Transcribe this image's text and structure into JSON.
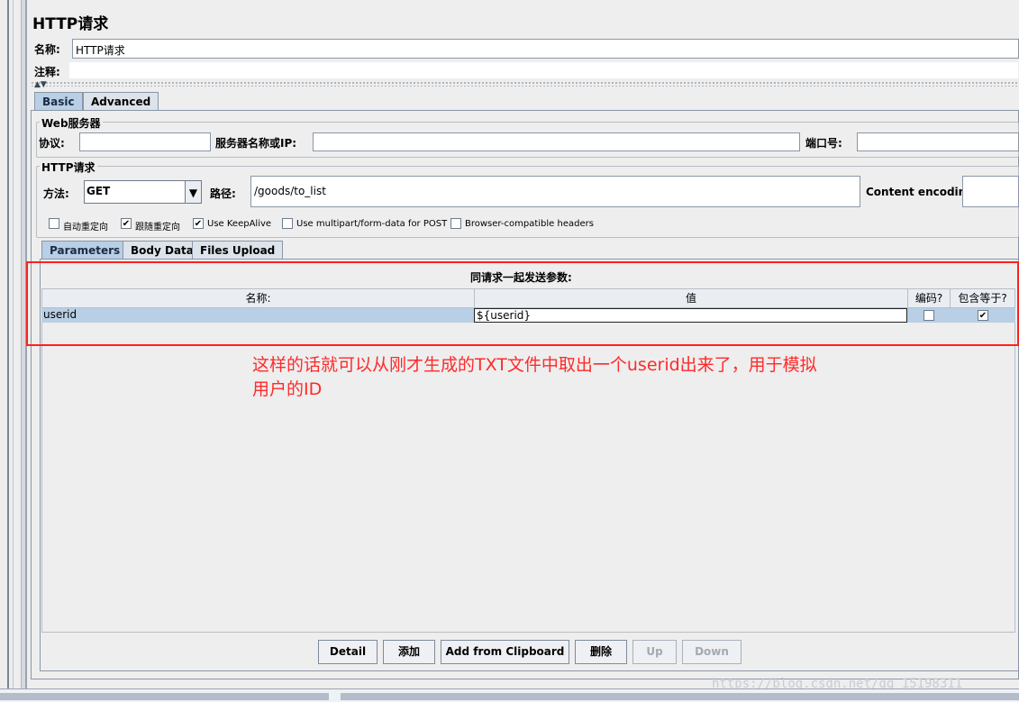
{
  "window": {
    "title": "HTTP请求"
  },
  "fields": {
    "name_label": "名称:",
    "name_value": "HTTP请求",
    "comment_label": "注释:",
    "comment_value": ""
  },
  "tabs": [
    {
      "label": "Basic",
      "active": true
    },
    {
      "label": "Advanced",
      "active": false
    }
  ],
  "web_server": {
    "title": "Web服务器",
    "protocol_label": "协议:",
    "protocol_value": "",
    "server_label": "服务器名称或IP:",
    "server_value": "",
    "port_label": "端口号:",
    "port_value": ""
  },
  "http_request": {
    "title": "HTTP请求",
    "method_label": "方法:",
    "method_value": "GET",
    "path_label": "路径:",
    "path_value": "/goods/to_list",
    "encoding_label": "Content encoding:",
    "encoding_value": ""
  },
  "options": [
    {
      "label": "自动重定向",
      "checked": false
    },
    {
      "label": "跟随重定向",
      "checked": true
    },
    {
      "label": "Use KeepAlive",
      "checked": true
    },
    {
      "label": "Use multipart/form-data for POST",
      "checked": false
    },
    {
      "label": "Browser-compatible headers",
      "checked": false
    }
  ],
  "sub_tabs": [
    {
      "label": "Parameters",
      "active": true
    },
    {
      "label": "Body Data",
      "active": false
    },
    {
      "label": "Files Upload",
      "active": false
    }
  ],
  "params_table": {
    "caption": "同请求一起发送参数:",
    "columns": [
      "名称:",
      "值",
      "编码?",
      "包含等于?"
    ],
    "rows": [
      {
        "name": "userid",
        "value": "${userid}",
        "encode": false,
        "include_equals": true
      }
    ]
  },
  "annotation": {
    "line1": "这样的话就可以从刚才生成的TXT文件中取出一个userid出来了，用于模拟",
    "line2": "用户的ID",
    "color": "#ff2a2a"
  },
  "buttons": [
    {
      "label": "Detail",
      "enabled": true
    },
    {
      "label": "添加",
      "enabled": true
    },
    {
      "label": "Add from Clipboard",
      "enabled": true
    },
    {
      "label": "删除",
      "enabled": true
    },
    {
      "label": "Up",
      "enabled": false
    },
    {
      "label": "Down",
      "enabled": false
    }
  ],
  "watermark": "https://blog.csdn.net/qq_15198311"
}
